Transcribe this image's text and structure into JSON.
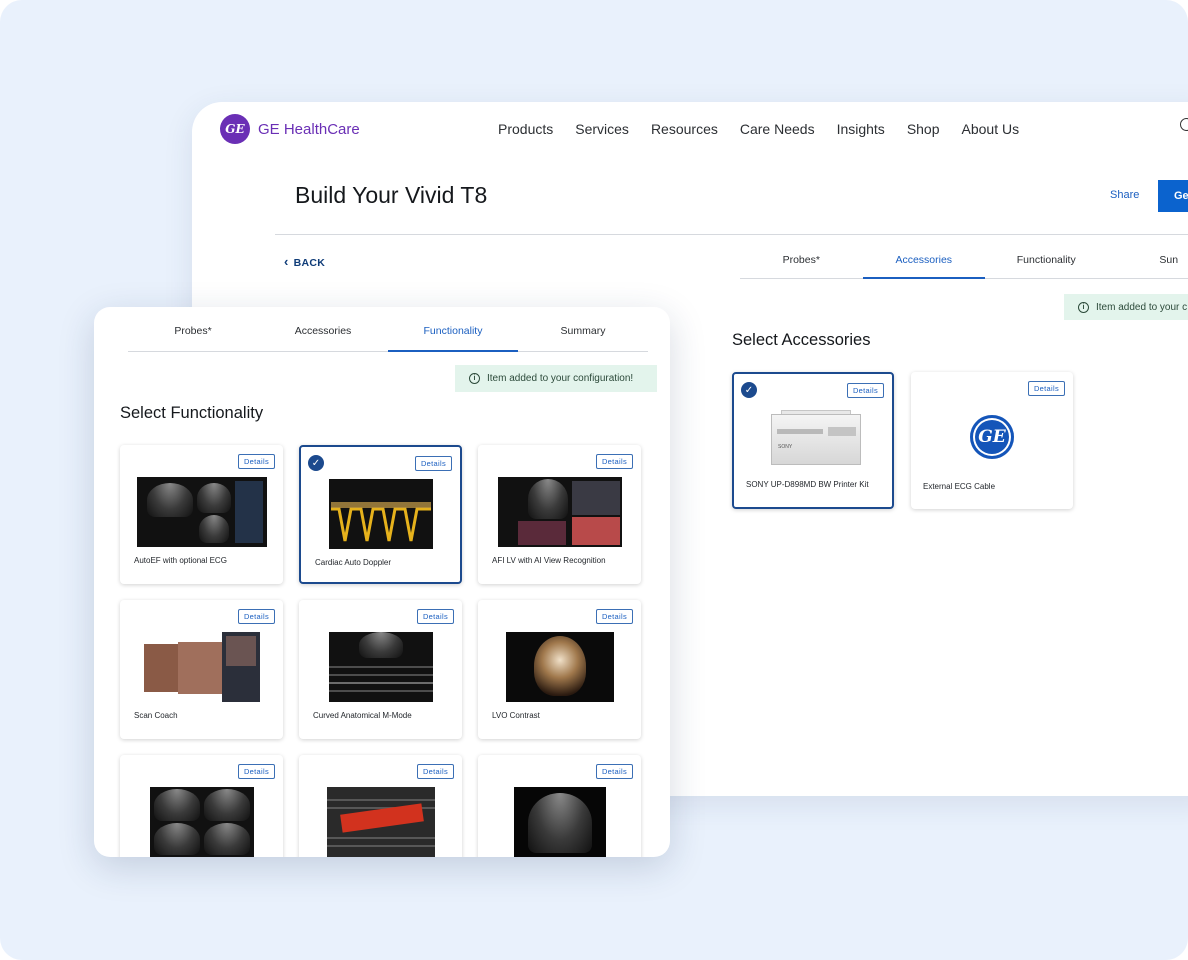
{
  "brand": {
    "name": "GE HealthCare",
    "logo_text": "GE"
  },
  "nav": [
    "Products",
    "Services",
    "Resources",
    "Care Needs",
    "Insights",
    "Shop",
    "About Us"
  ],
  "page": {
    "title": "Build Your Vivid T8",
    "share": "Share",
    "quote_btn": "Ge",
    "back": "BACK"
  },
  "back_window": {
    "tabs": [
      {
        "label": "Probes*",
        "active": false
      },
      {
        "label": "Accessories",
        "active": true
      },
      {
        "label": "Functionality",
        "active": false
      },
      {
        "label": "Sun",
        "active": false
      }
    ],
    "toast": "Item added to your c",
    "section_title": "Select Accessories",
    "cards": [
      {
        "label": "SONY UP-D898MD BW Printer Kit",
        "details": "Details",
        "selected": true,
        "printer_brand": "SONY"
      },
      {
        "label": "External ECG Cable",
        "details": "Details",
        "selected": false
      }
    ]
  },
  "front_window": {
    "tabs": [
      {
        "label": "Probes*",
        "active": false
      },
      {
        "label": "Accessories",
        "active": false
      },
      {
        "label": "Functionality",
        "active": true
      },
      {
        "label": "Summary",
        "active": false
      }
    ],
    "toast": "Item added to your configuration!",
    "section_title": "Select Functionality",
    "cards": [
      {
        "label": "AutoEF with optional ECG",
        "details": "Details",
        "selected": false
      },
      {
        "label": "Cardiac Auto Doppler",
        "details": "Details",
        "selected": true
      },
      {
        "label": "AFI LV with AI View Recognition",
        "details": "Details",
        "selected": false
      },
      {
        "label": "Scan Coach",
        "details": "Details",
        "selected": false
      },
      {
        "label": "Curved Anatomical M-Mode",
        "details": "Details",
        "selected": false
      },
      {
        "label": "LVO Contrast",
        "details": "Details",
        "selected": false
      },
      {
        "label": "",
        "details": "Details",
        "selected": false
      },
      {
        "label": "",
        "details": "Details",
        "selected": false
      },
      {
        "label": "",
        "details": "Details",
        "selected": false
      }
    ]
  },
  "colors": {
    "primary": "#0b63ce",
    "brand_purple": "#6a2fb5",
    "selected_border": "#1c4a8e",
    "toast_bg": "#e3f4ec",
    "background": "#e9f1fc"
  }
}
